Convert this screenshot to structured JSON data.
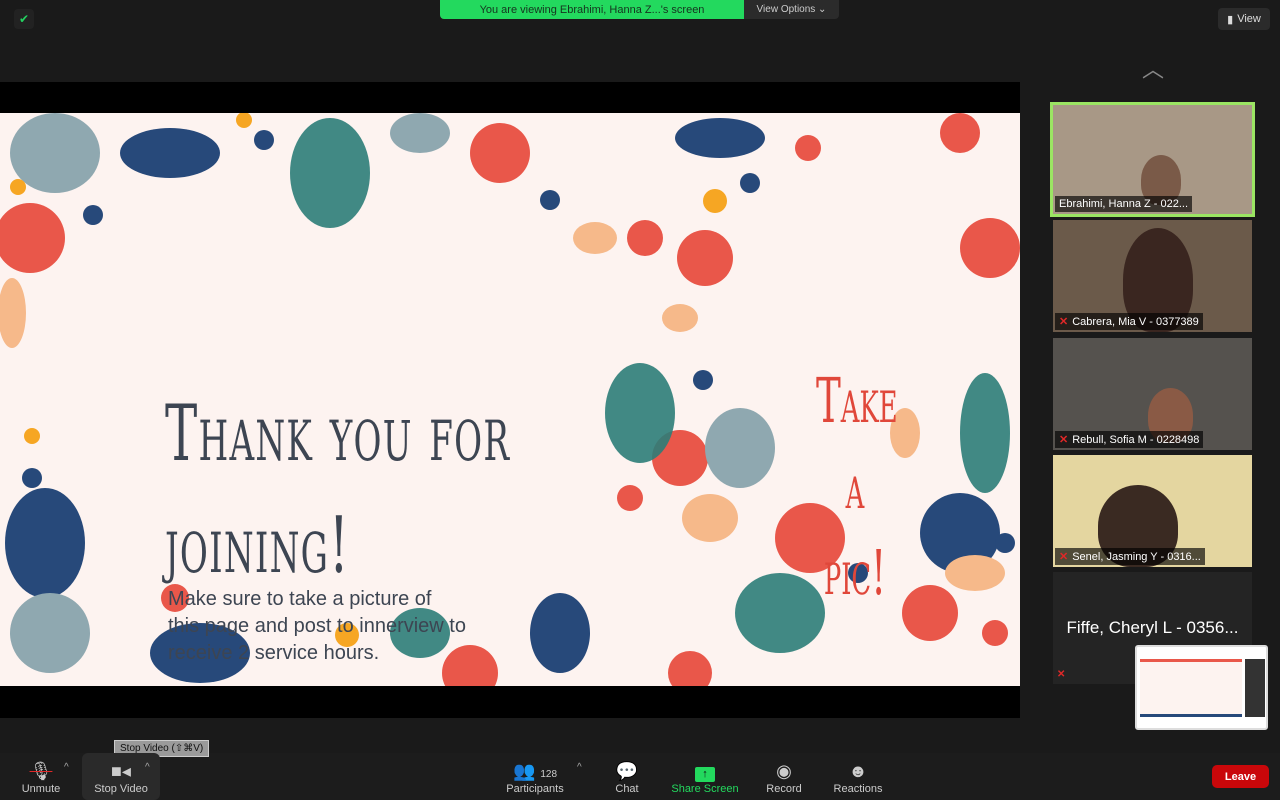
{
  "top": {
    "banner": "You are viewing Ebrahimi, Hanna Z...'s screen",
    "view_options": "View Options ⌄",
    "view": "View"
  },
  "slide": {
    "title_line1": "Thank you for",
    "title_line2": "joining!",
    "body": "Make sure to take a picture of this page and post to innerview to receive 2 service hours.",
    "side_line1": "Take a",
    "side_line2": "pic!"
  },
  "participants": [
    {
      "name": "Ebrahimi, Hanna Z - 022...",
      "muted": false,
      "active_speaker": true
    },
    {
      "name": "Cabrera, Mia V - 0377389",
      "muted": true
    },
    {
      "name": "Rebull, Sofia M - 0228498",
      "muted": true
    },
    {
      "name": "Senel, Jasming Y - 0316...",
      "muted": true
    },
    {
      "name": "Fiffe, Cheryl L - 0356...",
      "muted": true,
      "video_off": true
    }
  ],
  "tooltip": "Stop Video (⇧⌘V)",
  "toolbar": {
    "unmute": "Unmute",
    "stop_video": "Stop Video",
    "participants": "Participants",
    "participant_count": "128",
    "chat": "Chat",
    "share_screen": "Share Screen",
    "record": "Record",
    "reactions": "Reactions",
    "leave": "Leave"
  },
  "colors": {
    "banner": "#23d95e",
    "active_border": "#9be563",
    "leave": "#c9070a",
    "share": "#23d95e",
    "title": "#3d4552",
    "accent": "#e0473a"
  }
}
